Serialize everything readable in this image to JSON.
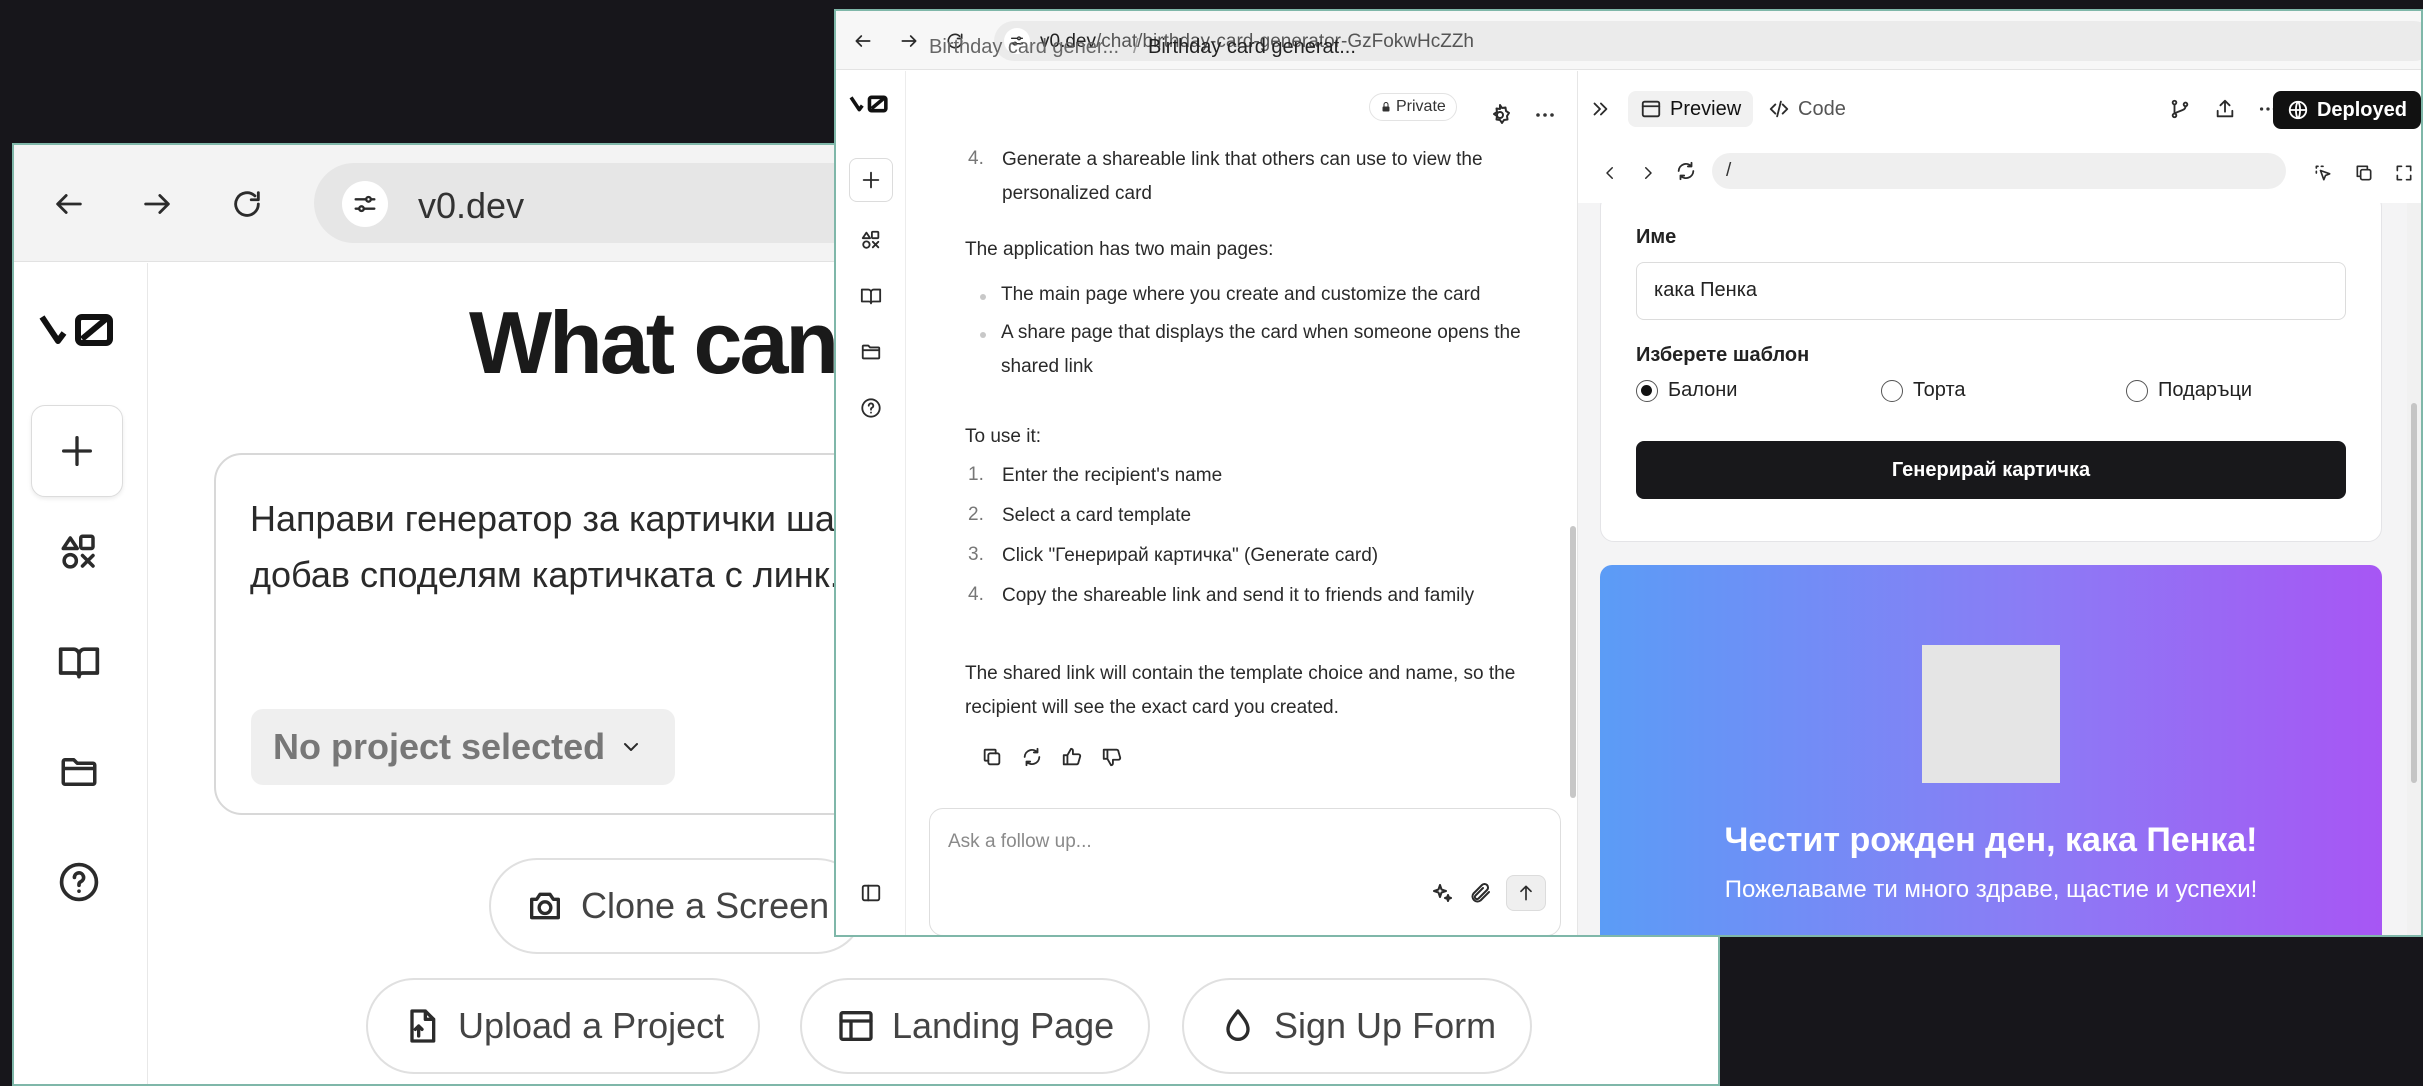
{
  "back_window": {
    "url": "v0.dev",
    "heading": "What can",
    "prompt_text": "Направи генератор за картички шаблон, въвеждам {име}, добав споделям картичката с линк.",
    "project_select": "No project selected",
    "chips": [
      "Clone a Screen",
      "Upload a Project",
      "Landing Page",
      "Sign Up Form"
    ]
  },
  "front_window": {
    "url_host": "v0.dev",
    "url_path": "/chat/birthday-card-generator-GzFokwHcZZh",
    "breadcrumb_project": "Birthday card gener...",
    "breadcrumb_separator": "/",
    "breadcrumb_chat": "Birthday card generat...",
    "privacy_badge": "Private",
    "chat": {
      "step4_num": "4.",
      "step4_text": "Generate a shareable link that others can use to view the personalized card",
      "pages_intro": "The application has two main pages:",
      "pages": [
        "The main page where you create and customize the card",
        "A share page that displays the card when someone opens the shared link"
      ],
      "usage_intro": "To use it:",
      "usage_steps": [
        {
          "num": "1.",
          "text": "Enter the recipient's name"
        },
        {
          "num": "2.",
          "text": "Select a card template"
        },
        {
          "num": "3.",
          "text": "Click \"Генерирай картичка\" (Generate card)"
        },
        {
          "num": "4.",
          "text": "Copy the shareable link and send it to friends and family"
        }
      ],
      "closing": "The shared link will contain the template choice and name, so the recipient will see the exact card you created."
    },
    "composer_placeholder": "Ask a follow up...",
    "tabs": {
      "preview": "Preview",
      "code": "Code"
    },
    "deployed_label": "Deployed",
    "preview_path": "/",
    "preview": {
      "name_label": "Име",
      "name_value": "кака Пенка",
      "template_label": "Изберете шаблон",
      "templates": [
        "Балони",
        "Торта",
        "Подаръци"
      ],
      "selected_template": "Балони",
      "generate_button": "Генерирай картичка",
      "card_title": "Честит рожден ден, кака Пенка!",
      "card_message": "Пожелаваме ти много здраве, щастие и успехи!",
      "card_colors": [
        "#5b9cf6",
        "#a756f4"
      ]
    }
  }
}
